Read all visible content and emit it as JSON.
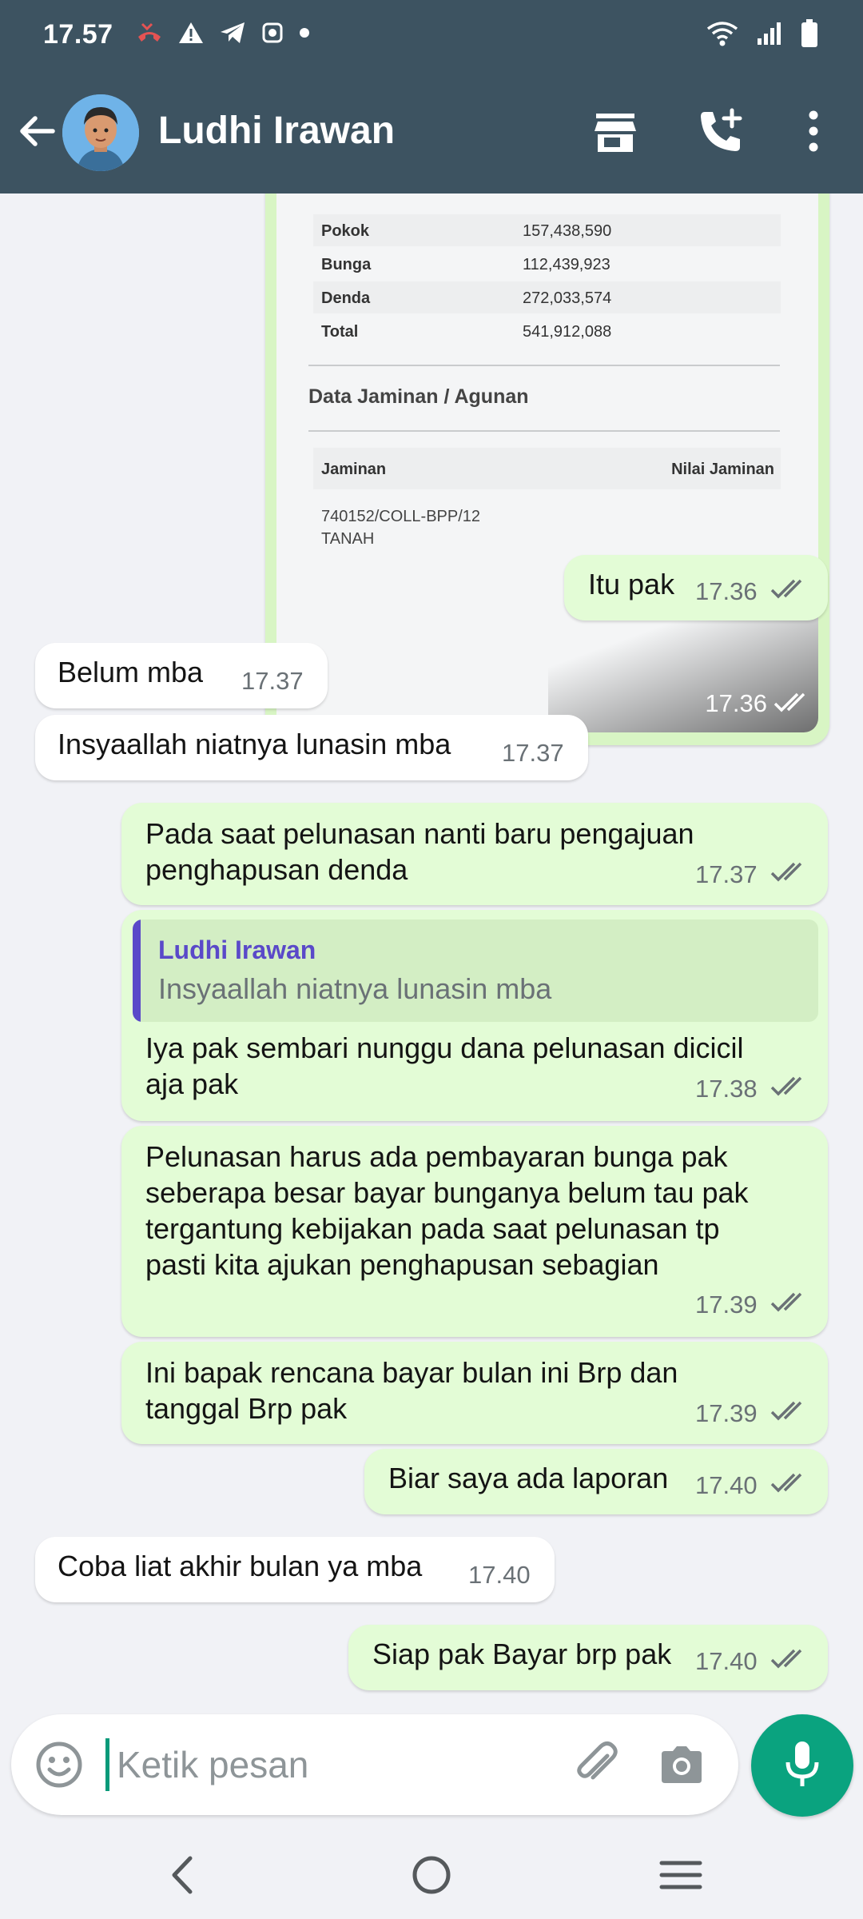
{
  "status_bar": {
    "time": "17.57"
  },
  "header": {
    "contact_name": "Ludhi Irawan"
  },
  "image_message": {
    "rows": [
      {
        "label": "Pokok",
        "value": "157,438,590"
      },
      {
        "label": "Bunga",
        "value": "112,439,923"
      },
      {
        "label": "Denda",
        "value": "272,033,574"
      },
      {
        "label": "Total",
        "value": "541,912,088"
      }
    ],
    "section_title": "Data Jaminan / Agunan",
    "col_left": "Jaminan",
    "col_right": "Nilai Jaminan",
    "item_line1": "740152/COLL-BPP/12",
    "item_line2": "TANAH",
    "time": "17.36"
  },
  "messages": [
    {
      "text": "Itu pak",
      "time": "17.36"
    },
    {
      "text": "Belum mba",
      "time": "17.37"
    },
    {
      "text": "Insyaallah niatnya lunasin mba",
      "time": "17.37"
    },
    {
      "line1": "Pada saat pelunasan nanti baru pengajuan",
      "line2": "penghapusan denda",
      "time": "17.37"
    },
    {
      "quote_name": "Ludhi Irawan",
      "quote_text": "Insyaallah niatnya lunasin mba",
      "line1": "Iya pak sembari nunggu dana pelunasan dicicil",
      "line2": "aja pak",
      "time": "17.38"
    },
    {
      "line1": "Pelunasan harus ada  pembayaran bunga pak",
      "line2": "seberapa besar bayar bunganya belum tau pak",
      "line3": "tergantung kebijakan pada saat pelunasan tp",
      "line4": "pasti kita ajukan penghapusan sebagian",
      "time": "17.39"
    },
    {
      "line1": "Ini bapak rencana bayar bulan ini Brp dan",
      "line2": "tanggal Brp pak",
      "time": "17.39"
    },
    {
      "text": "Biar saya ada laporan",
      "time": "17.40"
    },
    {
      "text": "Coba liat akhir bulan ya mba",
      "time": "17.40"
    },
    {
      "text": "Siap pak Bayar brp pak",
      "time": "17.40"
    }
  ],
  "input": {
    "placeholder": "Ketik pesan"
  },
  "colors": {
    "header": "#3d5361",
    "outgoing_bubble": "#e3fcd6",
    "incoming_bubble": "#ffffff",
    "accent": "#0aa37f",
    "quote_bar": "#5a49c9"
  },
  "icons": [
    "back-arrow-icon",
    "store-icon",
    "add-call-icon",
    "more-vert-icon",
    "emoji-icon",
    "attach-icon",
    "camera-icon",
    "mic-icon"
  ]
}
